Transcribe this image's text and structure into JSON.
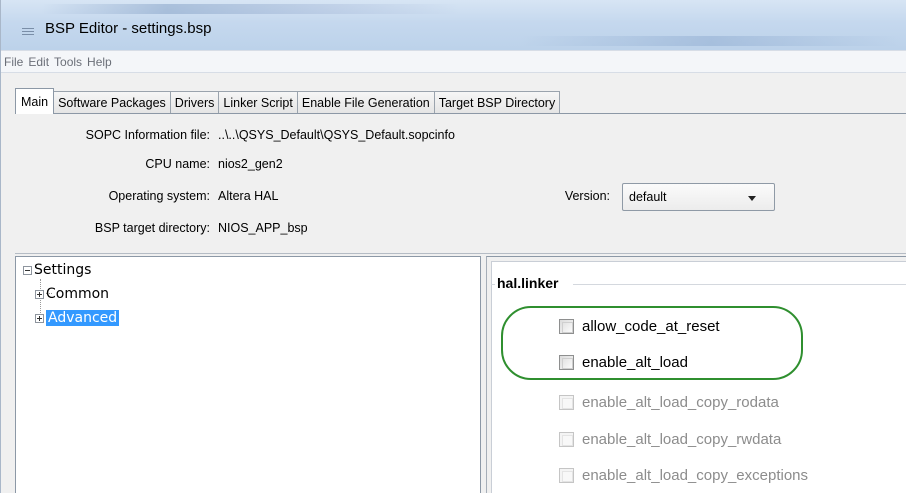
{
  "window": {
    "title": "BSP Editor - settings.bsp"
  },
  "menu": [
    "File",
    "Edit",
    "Tools",
    "Help"
  ],
  "tabs": [
    "Main",
    "Software Packages",
    "Drivers",
    "Linker Script",
    "Enable File Generation",
    "Target BSP Directory"
  ],
  "active_tab": "Main",
  "info": {
    "sopc_label": "SOPC Information file:",
    "sopc_value": "..\\..\\QSYS_Default\\QSYS_Default.sopcinfo",
    "cpu_label": "CPU name:",
    "cpu_value": "nios2_gen2",
    "os_label": "Operating system:",
    "os_value": "Altera HAL",
    "version_label": "Version:",
    "version_value": "default",
    "bsp_dir_label": "BSP target directory:",
    "bsp_dir_value": "NIOS_APP_bsp"
  },
  "tree": {
    "root": "Settings",
    "children": [
      "Common",
      "Advanced"
    ],
    "selected": "Advanced"
  },
  "group": {
    "title": "hal.linker",
    "options": [
      {
        "label": "allow_code_at_reset",
        "enabled": true,
        "checked": false
      },
      {
        "label": "enable_alt_load",
        "enabled": true,
        "checked": false
      },
      {
        "label": "enable_alt_load_copy_rodata",
        "enabled": false,
        "checked": false
      },
      {
        "label": "enable_alt_load_copy_rwdata",
        "enabled": false,
        "checked": false
      },
      {
        "label": "enable_alt_load_copy_exceptions",
        "enabled": false,
        "checked": false
      }
    ]
  },
  "colors": {
    "selection": "#3399ff",
    "highlight_annotation": "#2f8f2f",
    "disabled_text": "#8c8c8c"
  }
}
